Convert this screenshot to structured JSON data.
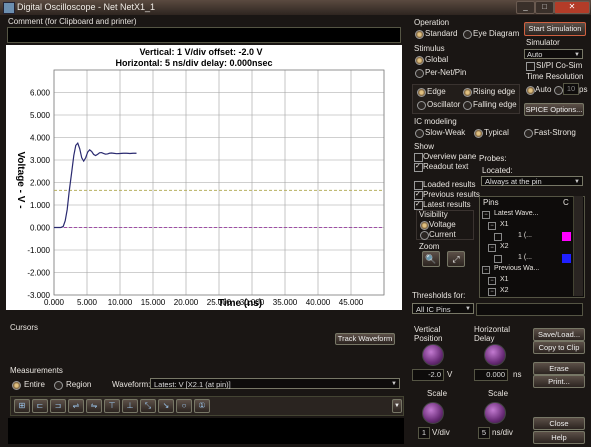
{
  "window": {
    "title": "Digital Oscilloscope - Net NetX1_1",
    "minimize": "_",
    "maximize": "□",
    "close": "✕"
  },
  "comment": {
    "label": "Comment (for Clipboard and printer)",
    "value": ""
  },
  "scope": {
    "readout_vertical": "Vertical: 1  V/div  offset: -2.0 V",
    "readout_horizontal": "Horizontal: 5 ns/div  delay: 0.000nsec",
    "ylabel": "Voltage  - V -",
    "xlabel": "Time  (ns)",
    "ytick_labels": [
      "6.000",
      "5.000",
      "4.000",
      "3.000",
      "2.000",
      "1.000",
      "0.000",
      "-1.000",
      "-2.000",
      "-3.000"
    ],
    "xtick_labels": [
      "0.000",
      "5.000",
      "10.000",
      "15.000",
      "20.000",
      "25.000",
      "30.000",
      "35.000",
      "40.000",
      "45.000"
    ]
  },
  "chart_data": {
    "type": "line",
    "title": "",
    "xlabel": "Time  (ns)",
    "ylabel": "Voltage  - V -",
    "xlim": [
      0,
      50
    ],
    "ylim": [
      -3,
      7
    ],
    "grid": true,
    "reference_lines": [
      {
        "y": 1.65,
        "style": "dashed",
        "color": "#b8b060"
      },
      {
        "y": 0.0,
        "style": "dashed",
        "color": "#a04ca8"
      }
    ],
    "series": [
      {
        "color": "#2a2a70",
        "x": [
          0,
          1.0,
          1.4,
          1.7,
          2.0,
          2.3,
          2.7,
          3.0,
          3.3,
          3.6,
          3.9,
          4.2,
          4.5,
          4.8,
          5.1,
          5.4,
          5.7,
          6.0,
          6.3,
          6.6,
          6.9,
          7.2,
          7.5,
          7.8,
          8.1,
          8.4,
          8.7,
          9.0,
          9.5,
          10.0,
          10.5,
          11.0,
          11.5,
          12.0,
          12.5
        ],
        "y": [
          0,
          0.0,
          0.05,
          0.3,
          0.8,
          1.6,
          2.5,
          3.2,
          3.65,
          3.75,
          3.5,
          3.1,
          2.95,
          3.1,
          3.35,
          3.45,
          3.38,
          3.25,
          3.2,
          3.25,
          3.32,
          3.33,
          3.29,
          3.26,
          3.27,
          3.3,
          3.31,
          3.3,
          3.28,
          3.29,
          3.3,
          3.3,
          3.29,
          3.3,
          3.3
        ]
      }
    ]
  },
  "cursors": {
    "label": "Cursors",
    "track_button": "Track Waveform"
  },
  "measurements": {
    "label": "Measurements",
    "entire": "Entire",
    "region": "Region",
    "waveform_label": "Waveform:",
    "waveform_value": "Latest: V [X2.1 (at pin)]"
  },
  "operation": {
    "header": "Operation",
    "standard": "Standard",
    "eye": "Eye Diagram"
  },
  "start_button": "Start Simulation",
  "simulator": {
    "header": "Simulator",
    "value": "Auto",
    "si_pi": "SI/PI Co-Sim"
  },
  "time_resolution": {
    "header": "Time Resolution",
    "auto": "Auto",
    "value": "10",
    "unit": "ps"
  },
  "spice_button": "SPICE Options...",
  "stimulus": {
    "header": "Stimulus",
    "global": "Global",
    "per_net": "Per-Net/Pin",
    "edge": "Edge",
    "oscillator": "Oscillator",
    "rising": "Rising edge",
    "falling": "Falling edge"
  },
  "ic_modeling": {
    "header": "IC modeling",
    "slow": "Slow-Weak",
    "typical": "Typical",
    "fast": "Fast-Strong"
  },
  "show": {
    "header": "Show",
    "overview": "Overview pane",
    "readout": "Readout text",
    "loaded": "Loaded results",
    "previous": "Previous results",
    "latest": "Latest results"
  },
  "visibility": {
    "header": "Visibility",
    "voltage": "Voltage",
    "current": "Current"
  },
  "zoom": {
    "header": "Zoom",
    "zoom_in": "🔍",
    "zoom_fit": "⤢"
  },
  "probes": {
    "header": "Probes:",
    "located_label": "Located:",
    "located_value": "Always at the pin"
  },
  "pins": {
    "col_pins": "Pins",
    "col_c": "C",
    "rows": [
      {
        "text": "Latest Wave...",
        "indent": 0,
        "color": ""
      },
      {
        "text": "X1",
        "indent": 1,
        "color": ""
      },
      {
        "text": "1 (...",
        "indent": 2,
        "color": "#ff00ff"
      },
      {
        "text": "X2",
        "indent": 1,
        "color": ""
      },
      {
        "text": "1 (...",
        "indent": 2,
        "color": "#2020ff"
      },
      {
        "text": "Previous Wa...",
        "indent": 0,
        "color": ""
      },
      {
        "text": "X1",
        "indent": 1,
        "color": ""
      },
      {
        "text": "X2",
        "indent": 1,
        "color": ""
      }
    ]
  },
  "thresholds": {
    "label": "Thresholds for:",
    "value": "All IC Pins"
  },
  "vertical": {
    "position_label": "Vertical\nPosition",
    "position_value": "-2.0",
    "position_unit": "V",
    "scale_label": "Scale",
    "scale_value": "1",
    "scale_unit": "V/div"
  },
  "horizontal": {
    "delay_label": "Horizontal\nDelay",
    "delay_value": "0.000",
    "delay_unit": "ns",
    "scale_label": "Scale",
    "scale_value": "5",
    "scale_unit": "ns/div"
  },
  "buttons": {
    "save_load": "Save/Load...",
    "copy": "Copy to Clip",
    "erase": "Erase",
    "print": "Print...",
    "close": "Close",
    "help": "Help"
  }
}
